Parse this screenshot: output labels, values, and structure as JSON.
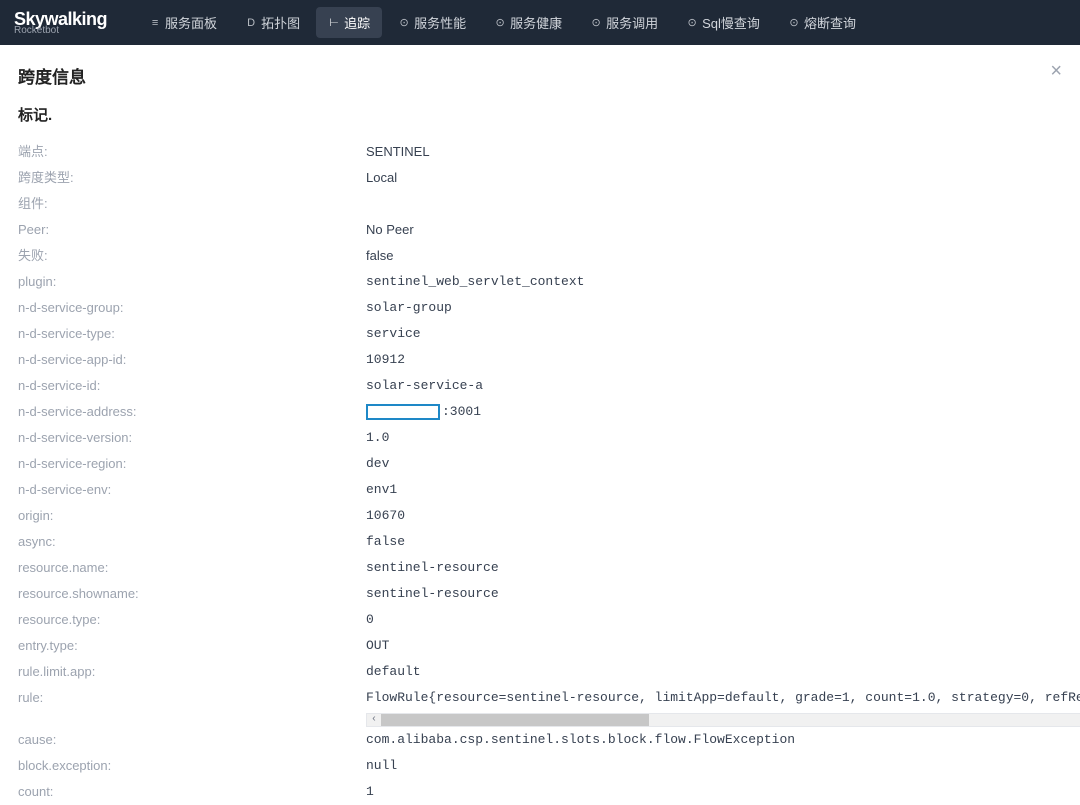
{
  "brand": {
    "name": "Skywalking",
    "sub": "Rocketbot"
  },
  "nav": {
    "items": [
      {
        "icon": "≡",
        "label": "服务面板"
      },
      {
        "icon": "D",
        "label": "拓扑图"
      },
      {
        "icon": "⊢",
        "label": "追踪"
      },
      {
        "icon": "⊙",
        "label": "服务性能"
      },
      {
        "icon": "⊙",
        "label": "服务健康"
      },
      {
        "icon": "⊙",
        "label": "服务调用"
      },
      {
        "icon": "⊙",
        "label": "Sql慢查询"
      },
      {
        "icon": "⊙",
        "label": "熔断查询"
      }
    ],
    "activeIndex": 2
  },
  "panel": {
    "title": "跨度信息",
    "section": "标记.",
    "rows": [
      {
        "key": "端点:",
        "value": "SENTINEL",
        "mono": false
      },
      {
        "key": "跨度类型:",
        "value": "Local",
        "mono": false
      },
      {
        "key": "组件:",
        "value": "",
        "mono": false
      },
      {
        "key": "Peer:",
        "value": "No Peer",
        "mono": false
      },
      {
        "key": "失败:",
        "value": "false",
        "mono": false
      },
      {
        "key": "plugin:",
        "value": "sentinel_web_servlet_context",
        "mono": true
      },
      {
        "key": "n-d-service-group:",
        "value": "solar-group",
        "mono": true
      },
      {
        "key": "n-d-service-type:",
        "value": "service",
        "mono": true
      },
      {
        "key": "n-d-service-app-id:",
        "value": "10912",
        "mono": true
      },
      {
        "key": "n-d-service-id:",
        "value": "solar-service-a",
        "mono": true
      },
      {
        "key": "n-d-service-address:",
        "value": ":3001",
        "mono": true,
        "redacted": true
      },
      {
        "key": "n-d-service-version:",
        "value": "1.0",
        "mono": true
      },
      {
        "key": "n-d-service-region:",
        "value": "dev",
        "mono": true
      },
      {
        "key": "n-d-service-env:",
        "value": "env1",
        "mono": true
      },
      {
        "key": "origin:",
        "value": "10670",
        "mono": true
      },
      {
        "key": "async:",
        "value": "false",
        "mono": true
      },
      {
        "key": "resource.name:",
        "value": "sentinel-resource",
        "mono": true
      },
      {
        "key": "resource.showname:",
        "value": "sentinel-resource",
        "mono": true
      },
      {
        "key": "resource.type:",
        "value": "0",
        "mono": true
      },
      {
        "key": "entry.type:",
        "value": "OUT",
        "mono": true
      },
      {
        "key": "rule.limit.app:",
        "value": "default",
        "mono": true
      },
      {
        "key": "rule:",
        "value": "FlowRule{resource=sentinel-resource, limitApp=default, grade=1, count=1.0, strategy=0, refResource=null, contro",
        "mono": true,
        "scroll": true
      },
      {
        "key": "cause:",
        "value": "com.alibaba.csp.sentinel.slots.block.flow.FlowException",
        "mono": true
      },
      {
        "key": "block.exception:",
        "value": "null",
        "mono": true
      },
      {
        "key": "count:",
        "value": "1",
        "mono": true
      }
    ]
  }
}
